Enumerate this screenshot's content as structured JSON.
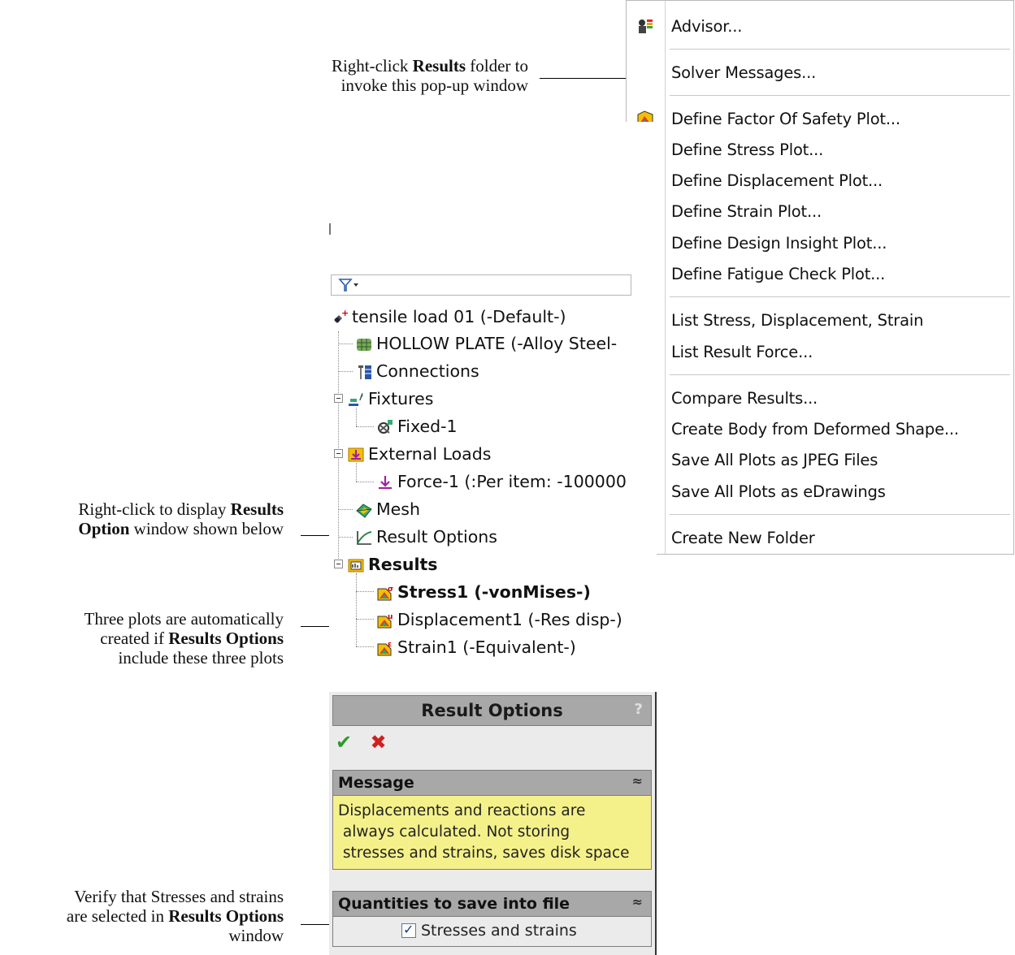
{
  "menu": {
    "items": [
      {
        "label": "Advisor...",
        "icon": "advisor-icon"
      },
      {
        "label": "Solver Messages..."
      },
      {
        "label": "Define Factor Of Safety Plot...",
        "icon": "fos-plot-icon"
      },
      {
        "label": "Define Stress Plot...",
        "icon": "stress-plot-icon"
      },
      {
        "label": "Define Displacement Plot...",
        "icon": "displacement-plot-icon"
      },
      {
        "label": "Define Strain Plot...",
        "icon": "strain-plot-icon"
      },
      {
        "label": "Define Design Insight Plot..."
      },
      {
        "label": "Define Fatigue Check Plot..."
      },
      {
        "label": "List Stress, Displacement, Strain"
      },
      {
        "label": "List Result Force...",
        "icon": "result-force-icon"
      },
      {
        "label": "Compare Results..."
      },
      {
        "label": "Create Body from Deformed Shape..."
      },
      {
        "label": "Save All Plots as JPEG Files"
      },
      {
        "label": "Save All Plots as eDrawings"
      },
      {
        "label": "Create New Folder"
      }
    ]
  },
  "tree": {
    "filter_icon": "filter-icon",
    "nodes": [
      {
        "label": "tensile load 01 (-Default-)"
      },
      {
        "label": "HOLLOW PLATE (-Alloy Steel-"
      },
      {
        "label": "Connections"
      },
      {
        "label": "Fixtures"
      },
      {
        "label": "Fixed-1"
      },
      {
        "label": "External Loads"
      },
      {
        "label": "Force-1 (:Per item: -100000"
      },
      {
        "label": "Mesh"
      },
      {
        "label": "Result Options"
      },
      {
        "label": "Results"
      },
      {
        "label": "Stress1 (-vonMises-)"
      },
      {
        "label": "Displacement1 (-Res disp-)"
      },
      {
        "label": "Strain1 (-Equivalent-)"
      }
    ]
  },
  "result_options": {
    "title": "Result Options",
    "help": "?",
    "ok_icon": "✔",
    "cancel_icon": "✖",
    "message_header": "Message",
    "message_lines": [
      "Displacements and reactions are",
      " always calculated. Not storing",
      " stresses and strains, saves disk space"
    ],
    "quantities_header": "Quantities to save into file",
    "checkbox_label": "Stresses and strains",
    "checkbox_checked": true,
    "collapse_glyph": "≈"
  },
  "annotations": {
    "a1": {
      "pre": "Right-click ",
      "bold": "Results",
      "post": " folder to",
      "line2": "invoke this pop-up window"
    },
    "a2": {
      "line1_pre": "Right-click to display ",
      "line1_bold": "Results",
      "line2_bold": "Option",
      "line2_post": " window shown below"
    },
    "a3": {
      "line1": "Three plots are automatically",
      "line2_pre": "created if ",
      "line2_bold": "Results Options",
      "line3": "include these three plots"
    },
    "a4": {
      "line1": "Verify that Stresses and strains",
      "line2_pre": "are selected in ",
      "line2_bold": "Results Options",
      "line3": "window"
    }
  }
}
